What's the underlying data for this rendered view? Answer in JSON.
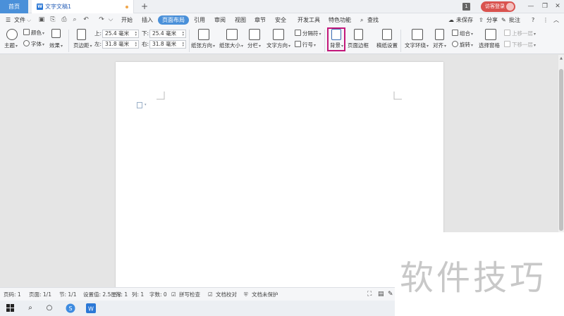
{
  "titlebar": {
    "home_tab": "首页",
    "doc_tab": "文字文稿1",
    "doc_icon": "W",
    "new_tab": "+",
    "badge": "1",
    "login": "访客登录",
    "minimize": "—",
    "restore": "❐",
    "close": "✕"
  },
  "menubar": {
    "file": "文件",
    "tabs": [
      "开始",
      "插入",
      "页面布局",
      "引用",
      "审阅",
      "视图",
      "章节",
      "安全",
      "开发工具",
      "特色功能"
    ],
    "active_tab": "页面布局",
    "search": "查找",
    "unsaved": "未保存",
    "share": "分享",
    "comment": "批注",
    "help": "?"
  },
  "ribbon": {
    "theme": "主题",
    "colors": "颜色",
    "fonts": "字体",
    "effects": "效果",
    "margins": "页边距",
    "top_label": "上:",
    "top_value": "25.4 毫米",
    "bottom_label": "下:",
    "bottom_value": "25.4 毫米",
    "left_label": "左:",
    "left_value": "31.8 毫米",
    "right_label": "右:",
    "right_value": "31.8 毫米",
    "orientation": "纸张方向",
    "size": "纸张大小",
    "columns": "分栏",
    "text_direction": "文字方向",
    "breaks": "分隔符",
    "line_numbers": "行号",
    "background": "背景",
    "page_border": "页面边框",
    "paper_setup": "稿纸设置",
    "text_wrap": "文字环绕",
    "align": "对齐",
    "group": "组合",
    "rotate": "旋转",
    "selection_pane": "选择窗格",
    "bring_forward": "上移一层",
    "send_backward": "下移一层"
  },
  "statusbar": {
    "page": "页码: 1",
    "pages": "页面: 1/1",
    "section": "节: 1/1",
    "setting": "设置值: 2.5厘米",
    "row": "行: 1",
    "col": "列: 1",
    "words": "字数: 0",
    "spell": "拼写检查",
    "proof": "文档校对",
    "protect": "文档未保护"
  },
  "watermark": "软件技巧"
}
